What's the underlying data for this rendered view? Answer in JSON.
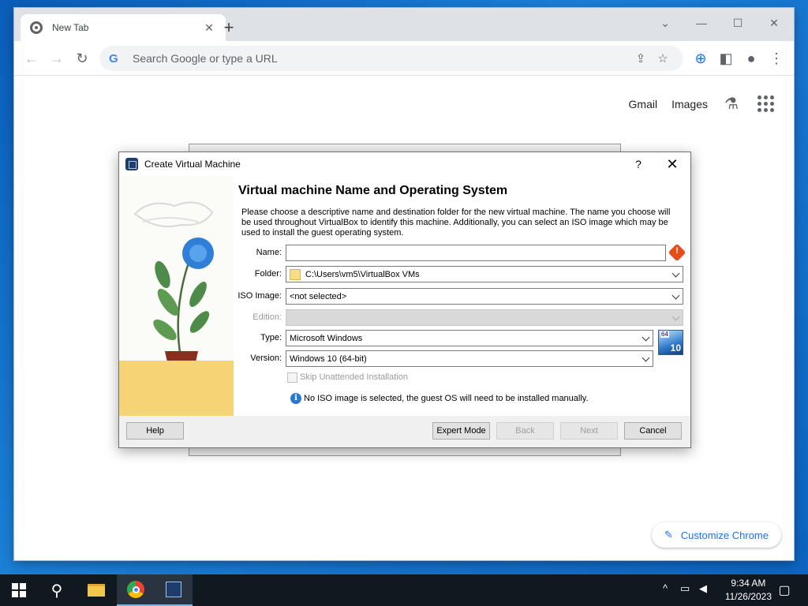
{
  "browser": {
    "tab_title": "New Tab",
    "tab_close": "✕",
    "new_tab": "+",
    "omnibox_placeholder": "Search Google or type a URL",
    "ntp_links": {
      "gmail": "Gmail",
      "images": "Images"
    },
    "customize_label": "Customize Chrome"
  },
  "dialog": {
    "title": "Create Virtual Machine",
    "help_glyph": "?",
    "close_glyph": "✕",
    "heading": "Virtual machine Name and Operating System",
    "description": "Please choose a descriptive name and destination folder for the new virtual machine. The name you choose will be used throughout VirtualBox to identify this machine. Additionally, you can select an ISO image which may be used to install the guest operating system.",
    "fields": {
      "name_label": "Name:",
      "name_value": "",
      "folder_label": "Folder:",
      "folder_value": "C:\\Users\\vm5\\VirtualBox VMs",
      "iso_label": "ISO Image:",
      "iso_value": "<not selected>",
      "edition_label": "Edition:",
      "edition_value": "",
      "type_label": "Type:",
      "type_value": "Microsoft Windows",
      "version_label": "Version:",
      "version_value": "Windows 10 (64-bit)"
    },
    "os_badge": {
      "bits": "64",
      "version": "10"
    },
    "skip_unattended": "Skip Unattended Installation",
    "info_message": "No ISO image is selected, the guest OS will need to be installed manually.",
    "buttons": {
      "help": "Help",
      "expert": "Expert Mode",
      "back": "Back",
      "next": "Next",
      "cancel": "Cancel"
    }
  },
  "taskbar": {
    "time": "9:34 AM",
    "date": "11/26/2023"
  },
  "icons": {
    "warning": "warning-icon",
    "info": "info-icon"
  }
}
